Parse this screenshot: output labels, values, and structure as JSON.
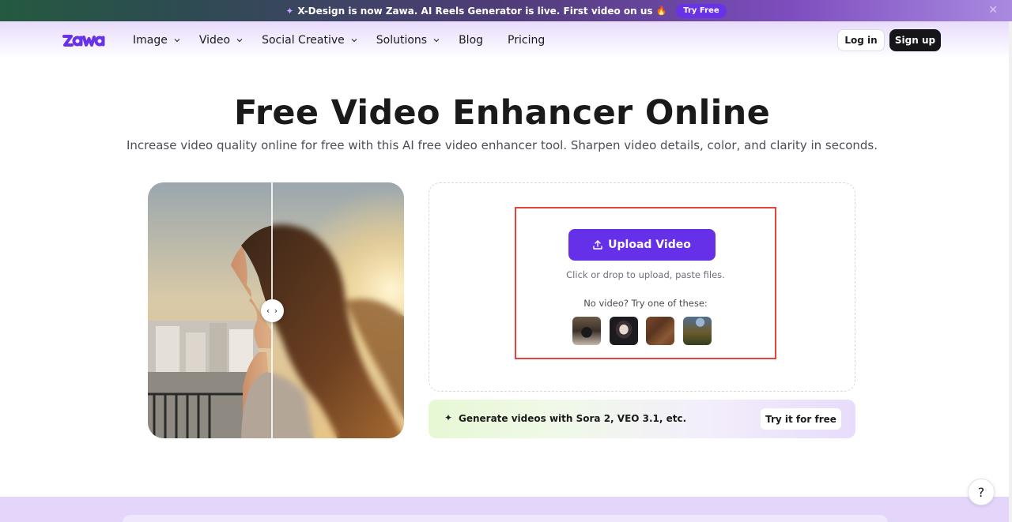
{
  "announcement": {
    "text": "X-Design is now Zawa. AI Reels Generator is live. First video on us",
    "cta": "Try Free"
  },
  "header": {
    "logo_text": "Zawa",
    "nav": [
      "Image",
      "Video",
      "Social Creative",
      "Solutions",
      "Blog",
      "Pricing"
    ],
    "login": "Log in",
    "signup": "Sign up"
  },
  "hero": {
    "title": "Free Video Enhancer Online",
    "subtitle": "Increase video quality online for free with this AI free video enhancer tool. Sharpen video details, color, and clarity in seconds."
  },
  "upload": {
    "button": "Upload Video",
    "hint": "Click or drop to upload, paste files.",
    "sample_prompt": "No video? Try one of these:",
    "samples": [
      "sample-coffee",
      "sample-portrait",
      "sample-wood",
      "sample-landscape"
    ]
  },
  "promo": {
    "text": "Generate videos with Sora 2, VEO 3.1, etc.",
    "cta": "Try it for free"
  },
  "help": {
    "label": "?"
  },
  "colors": {
    "primary": "#6530e8",
    "highlight": "#e0463a",
    "dark_button": "#15151a"
  }
}
